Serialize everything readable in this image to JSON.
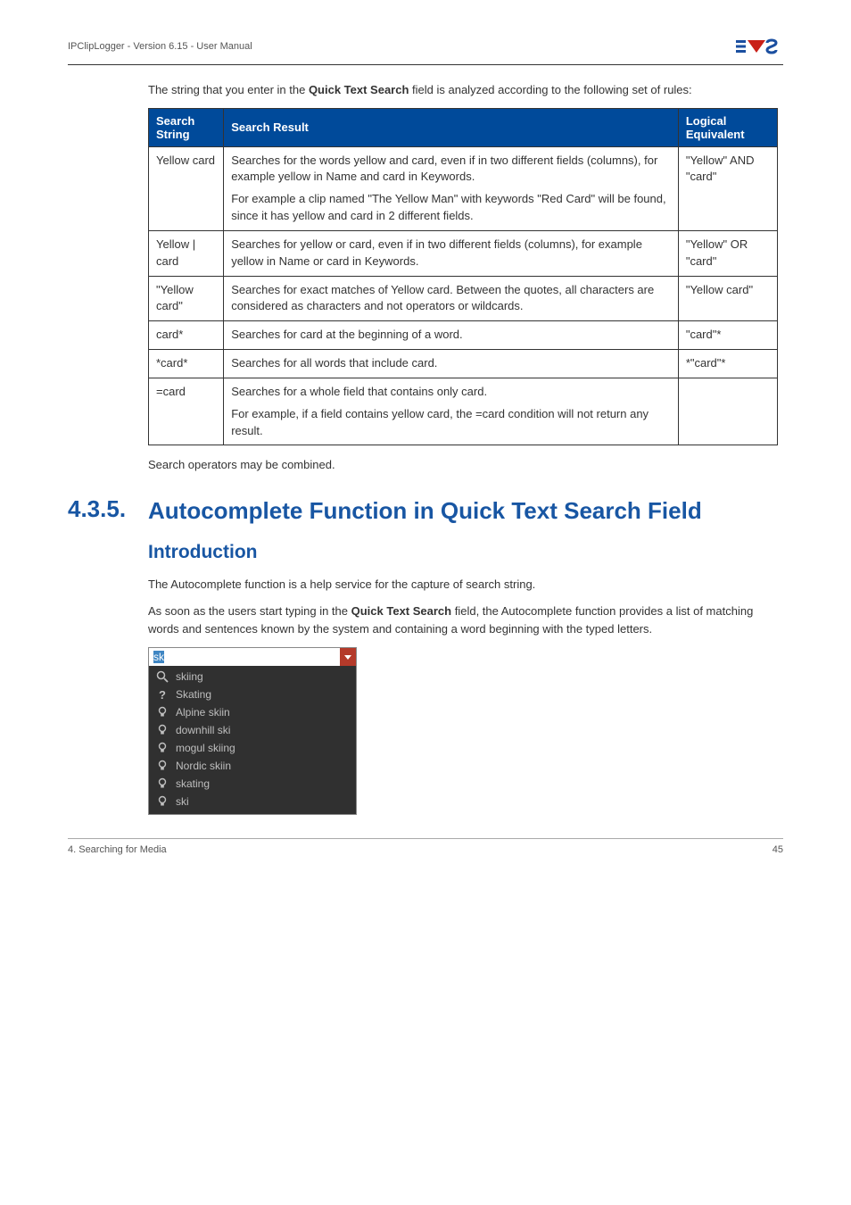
{
  "header": {
    "doc_title": "IPClipLogger - Version 6.15 - User Manual"
  },
  "intro": {
    "text_before_bold": "The string that you enter in the ",
    "bold": "Quick Text Search",
    "text_after_bold": " field is analyzed according to the following set of rules:"
  },
  "table": {
    "headers": {
      "c1": "Search String",
      "c2": "Search Result",
      "c3": "Logical Equivalent"
    },
    "rows": [
      {
        "c1": "Yellow card",
        "c2_p1": "Searches for the words yellow and card, even if in two different fields (columns), for example yellow in Name and card in Keywords.",
        "c2_p2": "For example a clip named \"The Yellow Man\" with keywords \"Red Card\" will be found, since it has yellow and card in 2 different fields.",
        "c3": "\"Yellow\" AND \"card\""
      },
      {
        "c1": "Yellow | card",
        "c2_p1": "Searches for yellow or card, even if in two different fields (columns), for example yellow in Name or card in Keywords.",
        "c3": "\"Yellow\" OR \"card\""
      },
      {
        "c1": "\"Yellow card\"",
        "c2_p1": "Searches for exact matches of Yellow card. Between the quotes, all characters are considered as characters and not operators or wildcards.",
        "c3": "\"Yellow card\""
      },
      {
        "c1": "card*",
        "c2_p1": "Searches for card at the beginning of a word.",
        "c3": "\"card\"*"
      },
      {
        "c1": "*card*",
        "c2_p1": "Searches for all words that include card.",
        "c3": "*\"card\"*"
      },
      {
        "c1": "=card",
        "c2_p1": "Searches for a whole field that contains only card.",
        "c2_p2": "For example, if a field contains yellow card, the =card condition will not return any result.",
        "c3": ""
      }
    ]
  },
  "combined_note": "Search operators may be combined.",
  "section": {
    "number": "4.3.5.",
    "title": "Autocomplete Function in Quick Text Search Field"
  },
  "subsection": {
    "title": "Introduction"
  },
  "para1": "The Autocomplete function is a help service for the capture of search string.",
  "para2": {
    "t1": "As soon as the users start typing in the ",
    "bold": "Quick Text Search",
    "t2": " field, the Autocomplete function provides a list of matching words and sentences known by the system and containing a word beginning with the typed letters."
  },
  "autocomplete": {
    "input_value": "sk",
    "items": [
      {
        "icon": "magnifier",
        "label": "skiing"
      },
      {
        "icon": "question",
        "label": "Skating"
      },
      {
        "icon": "bulb",
        "label": "Alpine skiin"
      },
      {
        "icon": "bulb",
        "label": "downhill ski"
      },
      {
        "icon": "bulb",
        "label": "mogul skiing"
      },
      {
        "icon": "bulb",
        "label": "Nordic skiin"
      },
      {
        "icon": "bulb",
        "label": "skating"
      },
      {
        "icon": "bulb",
        "label": "ski"
      }
    ]
  },
  "footer": {
    "left": "4. Searching for Media",
    "right": "45"
  }
}
